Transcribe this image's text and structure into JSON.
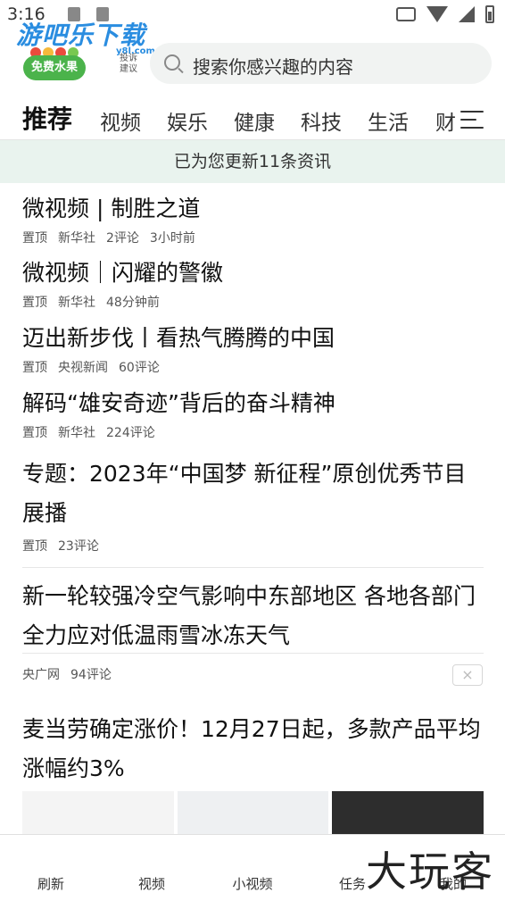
{
  "status_bar": {
    "time": "3:16"
  },
  "watermark": {
    "site_name": "游吧乐下载",
    "site_sub": "y8l.com"
  },
  "header": {
    "fruit_badge": "免费水果",
    "feedback_label": "投诉\n建议",
    "search_placeholder": "搜索你感兴趣的内容"
  },
  "tabs": [
    {
      "label": "推荐",
      "active": true
    },
    {
      "label": "视频"
    },
    {
      "label": "娱乐"
    },
    {
      "label": "健康"
    },
    {
      "label": "科技"
    },
    {
      "label": "生活"
    },
    {
      "label": "财"
    }
  ],
  "update_banner": "已为您更新11条资讯",
  "news": [
    {
      "title": "微视频 | 制胜之道",
      "meta": [
        "置顶",
        "新华社",
        "2评论",
        "3小时前"
      ]
    },
    {
      "title": "微视频｜闪耀的警徽",
      "meta": [
        "置顶",
        "新华社",
        "48分钟前"
      ]
    },
    {
      "title": "迈出新步伐丨看热气腾腾的中国",
      "meta": [
        "置顶",
        "央视新闻",
        "60评论"
      ]
    },
    {
      "title": "解码“雄安奇迹”背后的奋斗精神",
      "meta": [
        "置顶",
        "新华社",
        "224评论"
      ]
    },
    {
      "title": "专题：2023年“中国梦 新征程”原创优秀节目展播",
      "meta": [
        "置顶",
        "23评论"
      ]
    },
    {
      "title": "新一轮较强冷空气影响中东部地区 各地各部门全力应对低温雨雪冰冻天气",
      "meta": [
        "央广网",
        "94评论"
      ],
      "close": "×"
    },
    {
      "title": "麦当劳确定涨价！12月27日起，多款产品平均涨幅约3%"
    }
  ],
  "bottom_nav": [
    "刷新",
    "视频",
    "小视频",
    "任务",
    "我的"
  ],
  "brand_watermark": "大玩客"
}
